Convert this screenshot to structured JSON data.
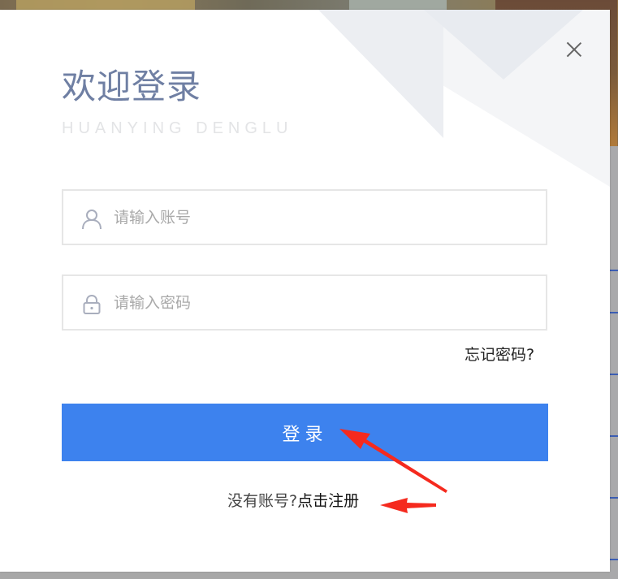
{
  "modal": {
    "title": "欢迎登录",
    "subtitle": "HUANYING DENGLU",
    "account_placeholder": "请输入账号",
    "password_placeholder": "请输入密码",
    "forgot_label": "忘记密码?",
    "login_label": "登录",
    "register_prompt": "没有账号?",
    "register_link": "点击注册"
  },
  "icons": {
    "close": "close-icon",
    "account": "user-icon",
    "password": "lock-icon"
  },
  "annotations": {
    "color": "#f52a1e"
  },
  "colors": {
    "primary": "#3d82ee",
    "title": "#6f7fa3",
    "decoration": "#f2f4f7"
  }
}
